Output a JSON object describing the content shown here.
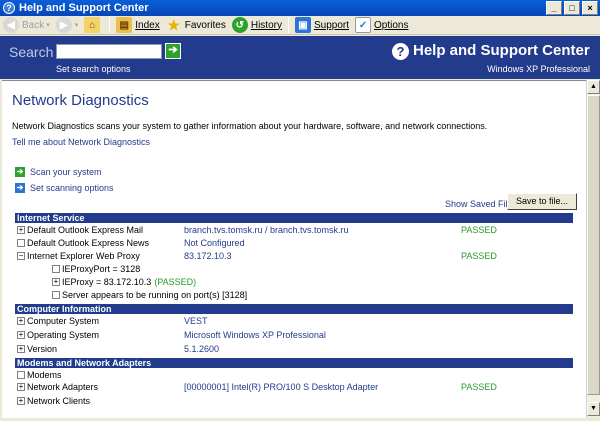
{
  "window": {
    "title": "Help and Support Center",
    "controls": [
      "_",
      "□",
      "×"
    ]
  },
  "toolbar": {
    "back": "Back",
    "index": "Index",
    "favorites": "Favorites",
    "history": "History",
    "support": "Support",
    "options": "Options"
  },
  "banner": {
    "search_label": "Search",
    "search_value": "",
    "set_search_options": "Set search options",
    "title": "Help and Support Center",
    "edition": "Windows XP Professional"
  },
  "page": {
    "title": "Network Diagnostics",
    "description": "Network Diagnostics scans your system to gather information about your hardware, software, and network connections.",
    "tell_me": "Tell me about Network Diagnostics",
    "actions": [
      "Scan your system",
      "Set scanning options"
    ],
    "show_saved": "Show Saved Files",
    "save_button": "Save to file..."
  },
  "sections": {
    "internet": {
      "header": "Internet Service",
      "rows": [
        {
          "label": "Default Outlook Express Mail",
          "value": "branch.tvs.tomsk.ru / branch.tvs.tomsk.ru",
          "status": "PASSED"
        },
        {
          "label": "Default Outlook Express News",
          "value": "Not Configured",
          "status": ""
        },
        {
          "label": "Internet Explorer Web Proxy",
          "value": "83.172.10.3",
          "status": "PASSED"
        }
      ],
      "proxy_details": {
        "port": "IEProxyPort = 3128",
        "proxy": "IEProxy = 83.172.10.3",
        "proxy_status": "(PASSED)",
        "server": "Server appears to be running on port(s) [3128]"
      }
    },
    "computer": {
      "header": "Computer Information",
      "rows": [
        {
          "label": "Computer System",
          "value": "VEST"
        },
        {
          "label": "Operating System",
          "value": "Microsoft Windows XP Professional"
        },
        {
          "label": "Version",
          "value": "5.1.2600"
        }
      ]
    },
    "modems": {
      "header": "Modems and Network Adapters",
      "rows": [
        {
          "label": "Modems",
          "value": "",
          "status": ""
        },
        {
          "label": "Network Adapters",
          "value": "[00000001] Intel(R) PRO/100 S Desktop Adapter",
          "status": "PASSED"
        },
        {
          "label": "Network Clients",
          "value": "",
          "status": ""
        }
      ]
    }
  },
  "colors": {
    "banner": "#223b8c",
    "link": "#223b8c",
    "passed": "#2a9a2a",
    "section_header": "#223b8c"
  }
}
